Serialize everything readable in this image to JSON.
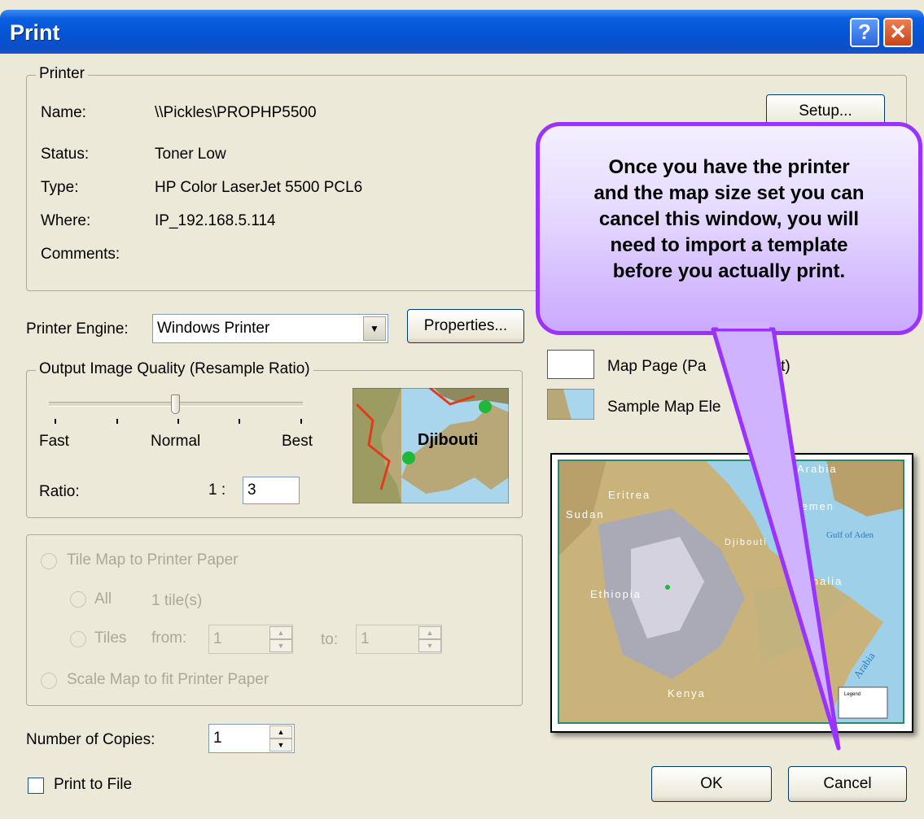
{
  "window": {
    "title": "Print",
    "help_glyph": "?",
    "close_glyph": "✕"
  },
  "printer": {
    "group_label": "Printer",
    "name_label": "Name:",
    "name_value": "\\\\Pickles\\PROPHP5500",
    "status_label": "Status:",
    "status_value": "Toner Low",
    "type_label": "Type:",
    "type_value": "HP Color LaserJet 5500 PCL6",
    "where_label": "Where:",
    "where_value": "IP_192.168.5.114",
    "comments_label": "Comments:",
    "setup_label": "Setup..."
  },
  "engine": {
    "label": "Printer Engine:",
    "value": "Windows Printer",
    "properties_label": "Properties..."
  },
  "quality": {
    "group_label": "Output Image Quality (Resample Ratio)",
    "fast_label": "Fast",
    "normal_label": "Normal",
    "best_label": "Best",
    "slider_level": 0.5,
    "ratio_label": "Ratio:",
    "ratio_prefix": "1 :",
    "ratio_value": "3",
    "preview_place": "Djibouti"
  },
  "tiling": {
    "tile_label": "Tile Map to Printer Paper",
    "all_label": "All",
    "tile_count": "1 tile(s)",
    "tiles_label": "Tiles",
    "from_label": "from:",
    "from_value": "1",
    "to_label": "to:",
    "to_value": "1",
    "scale_label": "Scale Map to fit Printer Paper"
  },
  "copies": {
    "label": "Number of Copies:",
    "value": "1"
  },
  "print_to_file": {
    "label": "Print to File",
    "checked": false
  },
  "legend": {
    "page_label": "Map Page (Pa",
    "page_label_tail": "out)",
    "sample_label": "Sample Map Ele"
  },
  "map_preview": {
    "labels": [
      "di Arabia",
      "Eritrea",
      "Sudan",
      "Yemen",
      "Gulf of Aden",
      "Djibouti",
      "Ethiopia",
      "omalia",
      "Arabia",
      "Kenya",
      "Legend"
    ]
  },
  "buttons": {
    "ok": "OK",
    "cancel": "Cancel"
  },
  "callout": {
    "lines": [
      "Once you have the printer",
      "and the map size set you can",
      "cancel this window, you will",
      "need to import a template",
      "before you actually print."
    ]
  },
  "colors": {
    "title_bar": "#0554d6",
    "dialog_bg": "#ece9d8",
    "callout_border": "#9a33ff",
    "callout_fill": "#e6dbff"
  }
}
